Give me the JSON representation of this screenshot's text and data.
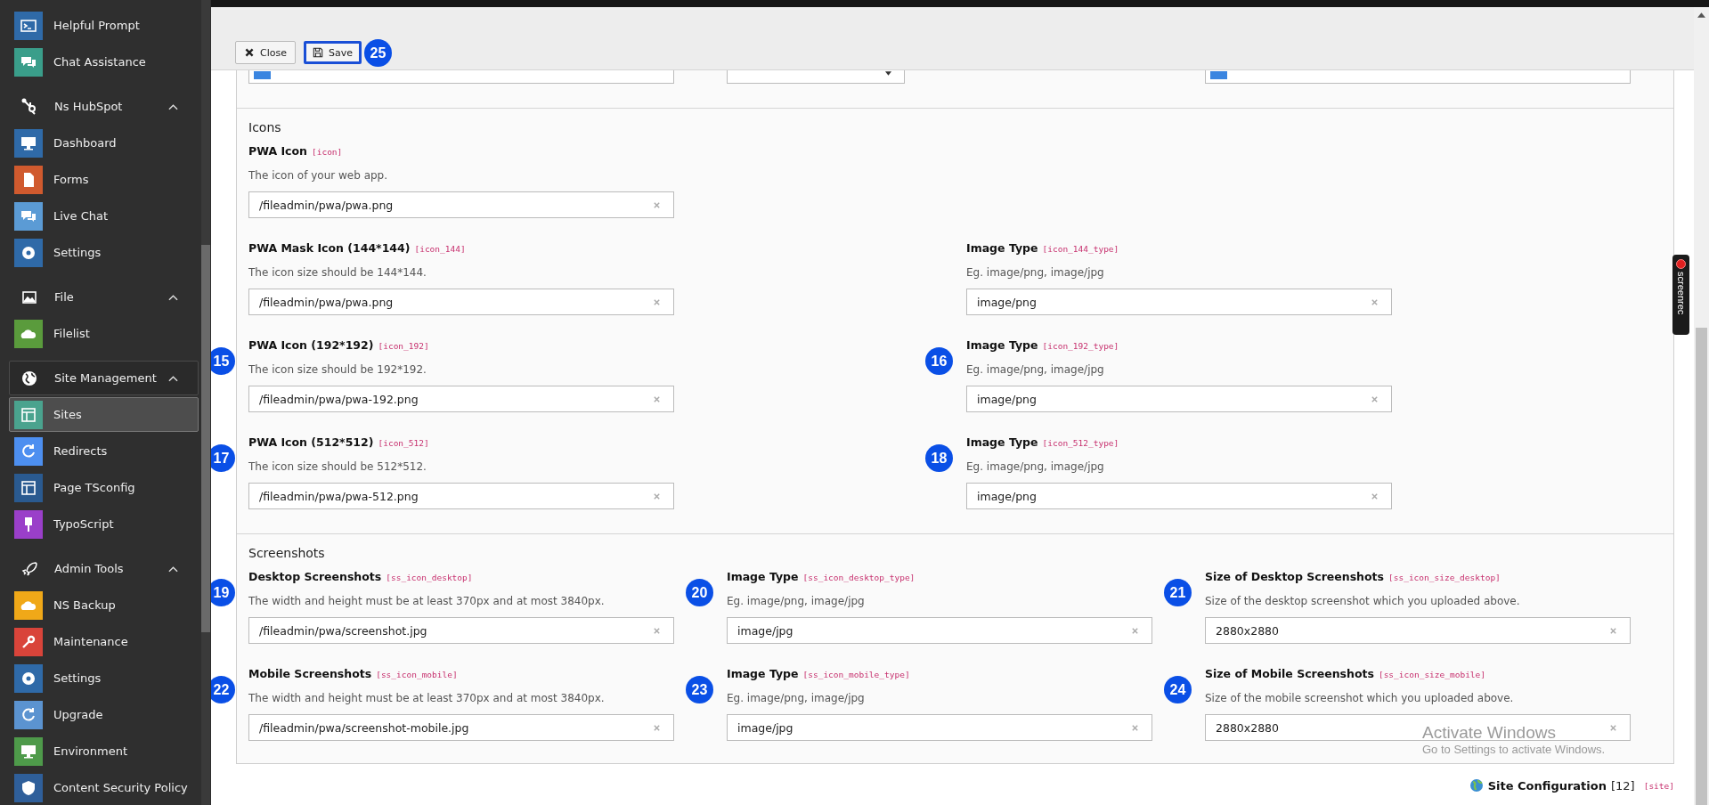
{
  "sidebar": {
    "groups": [
      {
        "items": [
          {
            "label": "Helpful Prompt",
            "selected": false,
            "color": "#2f6aa8"
          },
          {
            "label": "Chat Assistance",
            "selected": false,
            "color": "#3a9e8a"
          }
        ]
      },
      {
        "title": "Ns HubSpot",
        "expanded": true,
        "items": [
          {
            "label": "Dashboard",
            "selected": false,
            "color": "#2f6aa8"
          },
          {
            "label": "Forms",
            "selected": false,
            "color": "#d05a2e"
          },
          {
            "label": "Live Chat",
            "selected": false,
            "color": "#5b9bd5"
          },
          {
            "label": "Settings",
            "selected": false,
            "color": "#2f6aa8"
          }
        ]
      },
      {
        "title": "File",
        "expanded": true,
        "items": [
          {
            "label": "Filelist",
            "selected": false,
            "color": "#5a9b3c"
          }
        ]
      },
      {
        "title": "Site Management",
        "expanded": true,
        "items": [
          {
            "label": "Sites",
            "selected": true,
            "color": "#4aa38e"
          },
          {
            "label": "Redirects",
            "selected": false,
            "color": "#4d8ff0"
          },
          {
            "label": "Page TSconfig",
            "selected": false,
            "color": "#2a5a90"
          },
          {
            "label": "TypoScript",
            "selected": false,
            "color": "#9a3fc9"
          }
        ]
      },
      {
        "title": "Admin Tools",
        "expanded": true,
        "items": [
          {
            "label": "NS Backup",
            "selected": false,
            "color": "#f0a818"
          },
          {
            "label": "Maintenance",
            "selected": false,
            "color": "#d9443a"
          },
          {
            "label": "Settings",
            "selected": false,
            "color": "#2f6aa8"
          },
          {
            "label": "Upgrade",
            "selected": false,
            "color": "#5b93d0"
          },
          {
            "label": "Environment",
            "selected": false,
            "color": "#4e9a4a"
          },
          {
            "label": "Content Security Policy",
            "selected": false,
            "color": "#2f5f9a"
          }
        ]
      }
    ]
  },
  "toolbar": {
    "buttons": [
      {
        "label": "Close",
        "kind": "close",
        "highlighted": false
      },
      {
        "label": "Save",
        "kind": "save",
        "highlighted": true,
        "badge": "25"
      }
    ]
  },
  "top_row": {
    "fields": [
      {
        "kind": "color",
        "color": "#3a85e0"
      },
      {
        "kind": "select"
      },
      {
        "kind": "color",
        "color": "#3a85e0"
      }
    ]
  },
  "sections": [
    {
      "title": "Icons",
      "rows": [
        [
          {
            "label": "PWA Icon",
            "key": "[icon]",
            "description": "The icon of your web app.",
            "value": "/fileadmin/pwa/pwa.png"
          }
        ],
        [
          {
            "label": "PWA Mask Icon (144*144)",
            "key": "[icon_144]",
            "description": "The icon size should be 144*144.",
            "value": "/fileadmin/pwa/pwa.png"
          },
          {
            "label": "Image Type",
            "key": "[icon_144_type]",
            "description": "Eg. image/png, image/jpg",
            "value": "image/png"
          }
        ],
        [
          {
            "label": "PWA Icon (192*192)",
            "key": "[icon_192]",
            "description": "The icon size should be 192*192.",
            "value": "/fileadmin/pwa/pwa-192.png",
            "badge": "15"
          },
          {
            "label": "Image Type",
            "key": "[icon_192_type]",
            "description": "Eg. image/png, image/jpg",
            "value": "image/png",
            "badge": "16"
          }
        ],
        [
          {
            "label": "PWA Icon (512*512)",
            "key": "[icon_512]",
            "description": "The icon size should be 512*512.",
            "value": "/fileadmin/pwa/pwa-512.png",
            "badge": "17"
          },
          {
            "label": "Image Type",
            "key": "[icon_512_type]",
            "description": "Eg. image/png, image/jpg",
            "value": "image/png",
            "badge": "18"
          }
        ]
      ]
    },
    {
      "title": "Screenshots",
      "rows": [
        [
          {
            "label": "Desktop Screenshots",
            "key": "[ss_icon_desktop]",
            "description": "The width and height must be at least 370px and at most 3840px.",
            "value": "/fileadmin/pwa/screenshot.jpg",
            "badge": "19"
          },
          {
            "label": "Image Type",
            "key": "[ss_icon_desktop_type]",
            "description": "Eg. image/png, image/jpg",
            "value": "image/jpg",
            "badge": "20"
          },
          {
            "label": "Size of Desktop Screenshots",
            "key": "[ss_icon_size_desktop]",
            "description": "Size of the desktop screenshot which you uploaded above.",
            "value": "2880x2880",
            "badge": "21"
          }
        ],
        [
          {
            "label": "Mobile Screenshots",
            "key": "[ss_icon_mobile]",
            "description": "The width and height must be at least 370px and at most 3840px.",
            "value": "/fileadmin/pwa/screenshot-mobile.jpg",
            "badge": "22"
          },
          {
            "label": "Image Type",
            "key": "[ss_icon_mobile_type]",
            "description": "Eg. image/png, image/jpg",
            "value": "image/jpg",
            "badge": "23"
          },
          {
            "label": "Size of Mobile Screenshots",
            "key": "[ss_icon_size_mobile]",
            "description": "Size of the mobile screenshot which you uploaded above.",
            "value": "2880x2880",
            "badge": "24"
          }
        ]
      ]
    }
  ],
  "footer": {
    "title": "Site Configuration",
    "count": "[12]",
    "key": "[site]"
  },
  "recorder_tab": {
    "label": "screenrec"
  },
  "os_notice": {
    "title": "Activate Windows",
    "subtitle": "Go to Settings to activate Windows."
  }
}
